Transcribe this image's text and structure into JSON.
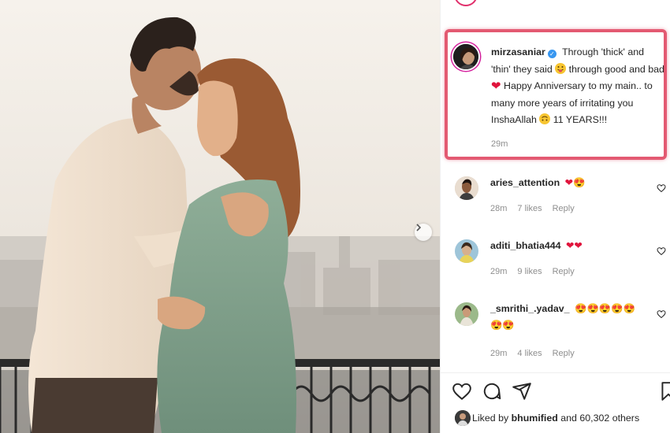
{
  "post": {
    "image_alt": "Couple embracing on a balcony"
  },
  "caption": {
    "username": "mirzasaniar",
    "verified_mark": "✓",
    "text_1": " Through 'thick' and 'thin' they said ",
    "text_2": " through good and bad ",
    "text_3": " Happy Anniversary to my main.. to many more years of irritating you InshaAllah ",
    "text_4": " 11 YEARS!!!",
    "time": "29m",
    "highlight_color": "#e35a72"
  },
  "comments": [
    {
      "username": "aries_attention",
      "emoji_text": "❤😍",
      "time": "28m",
      "likes": "7 likes",
      "reply": "Reply"
    },
    {
      "username": "aditi_bhatia444",
      "emoji_text": "❤❤",
      "time": "29m",
      "likes": "9 likes",
      "reply": "Reply"
    },
    {
      "username": "_smrithi_.yadav_",
      "emoji_text": "😍😍😍😍😍",
      "emoji_text_2": "😍😍",
      "time": "29m",
      "likes": "4 likes",
      "reply": "Reply"
    }
  ],
  "icons": {
    "heart": "heart-icon",
    "comment": "comment-icon",
    "share": "share-icon",
    "save": "bookmark-icon",
    "like": "heart-outline-icon",
    "next": "chevron-right-icon"
  },
  "likes": {
    "prefix": "Liked by ",
    "user": "bhumified",
    "suffix": " and 60,302 others"
  }
}
